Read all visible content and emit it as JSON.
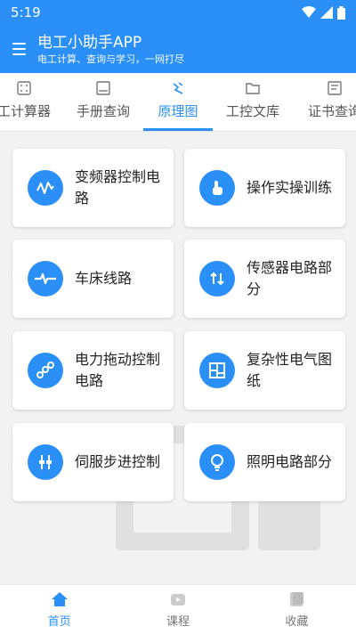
{
  "status_bar": {
    "time": "5:19"
  },
  "header": {
    "title": "电工小助手APP",
    "subtitle": "电工计算、查询与学习，一网打尽"
  },
  "tabs": [
    {
      "label": "工计算器",
      "icon": "calculator-icon"
    },
    {
      "label": "手册查询",
      "icon": "book-icon"
    },
    {
      "label": "原理图",
      "icon": "schematic-icon",
      "active": true
    },
    {
      "label": "工控文库",
      "icon": "folder-icon"
    },
    {
      "label": "证书查询",
      "icon": "certificate-icon"
    }
  ],
  "cards": [
    {
      "label": "变频器控制电路",
      "icon": "waveform-icon"
    },
    {
      "label": "操作实操训练",
      "icon": "hand-pointer-icon"
    },
    {
      "label": "车床线路",
      "icon": "pulse-icon"
    },
    {
      "label": "传感器电路部分",
      "icon": "arrows-icon"
    },
    {
      "label": "电力拖动控制电路",
      "icon": "nodes-icon"
    },
    {
      "label": "复杂性电气图纸",
      "icon": "blueprint-icon"
    },
    {
      "label": "伺服步进控制",
      "icon": "plug-icon"
    },
    {
      "label": "照明电路部分",
      "icon": "bulb-icon"
    }
  ],
  "bottom_nav": [
    {
      "label": "首页",
      "icon": "home-icon",
      "active": true
    },
    {
      "label": "课程",
      "icon": "video-icon"
    },
    {
      "label": "收藏",
      "icon": "bookmark-icon"
    }
  ],
  "colors": {
    "accent": "#2a8ff7",
    "background": "#f2f2f2"
  }
}
